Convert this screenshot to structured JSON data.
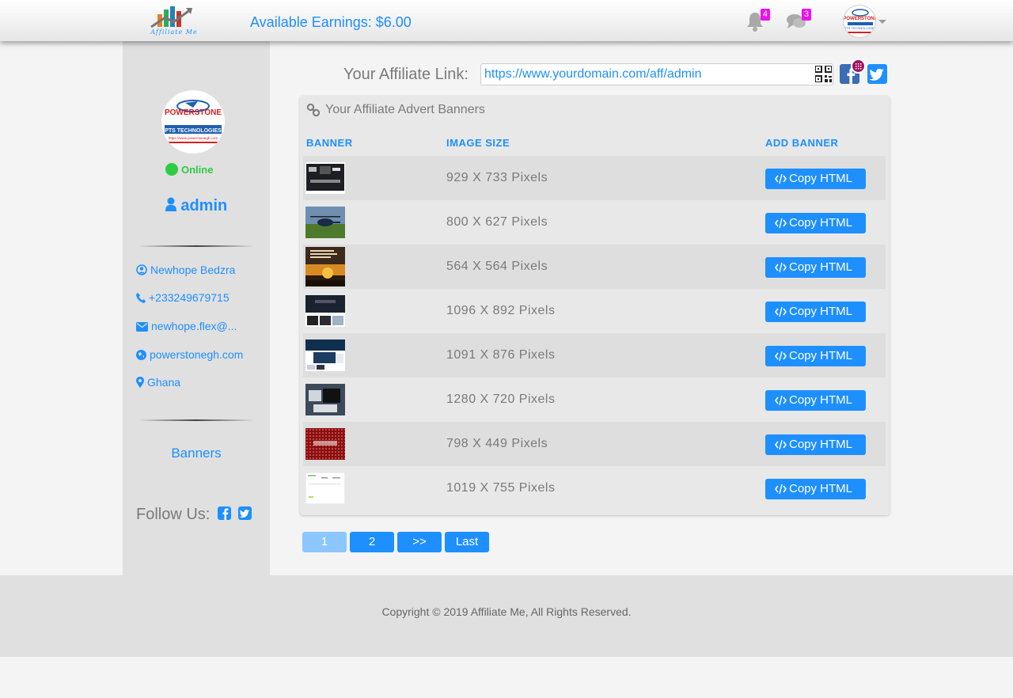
{
  "header": {
    "logo_text": "Affiliate Me",
    "earnings": "Available Earnings: $6.00",
    "notifications_count": "4",
    "messages_count": "3",
    "accent": "#1e8fff",
    "badge_color": "#ee10ee"
  },
  "avatar_lines": {
    "brand": "POWERSTONE",
    "sub": "PTS TECHNOLOGIES",
    "url": "https://www.powerstonegh.com"
  },
  "sidebar": {
    "status": "Online",
    "username": "admin",
    "full_name": "Newhope Bedzra",
    "phone": "+233249679715",
    "email": "newhope.flex@...",
    "website": "powerstonegh.com",
    "country": "Ghana",
    "nav_banners": "Banners",
    "follow_label": "Follow Us:"
  },
  "affiliate": {
    "label": "Your Affiliate Link:",
    "url": "https://www.yourdomain.com/aff/admin"
  },
  "panel": {
    "title": "Your Affiliate Advert Banners",
    "columns": [
      "BANNER",
      "IMAGE SIZE",
      "ADD BANNER"
    ],
    "copy_label": "Copy HTML",
    "rows": [
      {
        "size": "929 X 733 Pixels",
        "thumb": "dark-dashboard"
      },
      {
        "size": "800 X 627 Pixels",
        "thumb": "helicopter-field"
      },
      {
        "size": "564 X 564 Pixels",
        "thumb": "sunset-poster"
      },
      {
        "size": "1096 X 892 Pixels",
        "thumb": "dark-website"
      },
      {
        "size": "1091 X 876 Pixels",
        "thumb": "blue-website"
      },
      {
        "size": "1280 X 720 Pixels",
        "thumb": "desk-devices"
      },
      {
        "size": "798 X 449 Pixels",
        "thumb": "red-dots"
      },
      {
        "size": "1019 X 755 Pixels",
        "thumb": "white-page"
      }
    ]
  },
  "pagination": [
    "1",
    "2",
    ">>",
    "Last"
  ],
  "footer": {
    "copyright": "Copyright © 2019 Affiliate Me, All Rights Reserved."
  }
}
